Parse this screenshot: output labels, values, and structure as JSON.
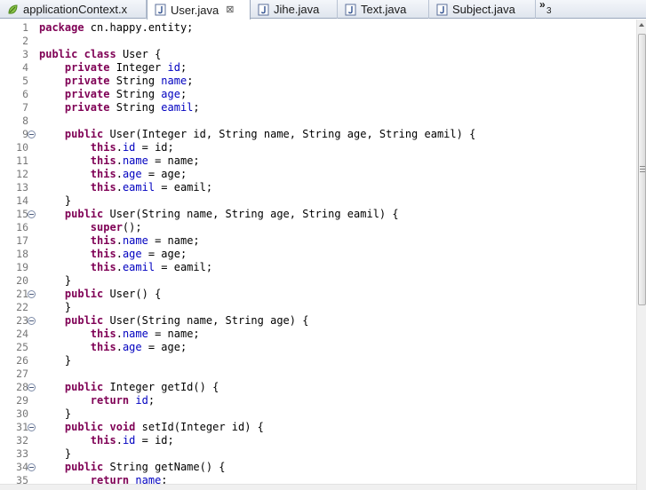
{
  "tabs": [
    {
      "label": "applicationContext.x",
      "icon": "xml-file-icon"
    },
    {
      "label": "User.java",
      "icon": "java-file-icon",
      "active": true,
      "close": "⊠"
    },
    {
      "label": "Jihe.java",
      "icon": "java-file-icon"
    },
    {
      "label": "Text.java",
      "icon": "java-file-icon"
    },
    {
      "label": "Subject.java",
      "icon": "java-file-icon"
    }
  ],
  "overflow": {
    "chevron": "»",
    "count": "3"
  },
  "colors": {
    "keyword": "#7f0055",
    "field": "#0000c0",
    "line_number": "#787878"
  },
  "lines": [
    {
      "n": "1",
      "fold": false,
      "tokens": [
        [
          "kw",
          "package"
        ],
        [
          "pl",
          " cn.happy.entity;"
        ]
      ]
    },
    {
      "n": "2",
      "fold": false,
      "tokens": []
    },
    {
      "n": "3",
      "fold": false,
      "tokens": [
        [
          "kw",
          "public"
        ],
        [
          "pl",
          " "
        ],
        [
          "kw",
          "class"
        ],
        [
          "pl",
          " User {"
        ]
      ]
    },
    {
      "n": "4",
      "fold": false,
      "tokens": [
        [
          "pl",
          "    "
        ],
        [
          "kw",
          "private"
        ],
        [
          "pl",
          " Integer "
        ],
        [
          "fd",
          "id"
        ],
        [
          "pl",
          ";"
        ]
      ]
    },
    {
      "n": "5",
      "fold": false,
      "tokens": [
        [
          "pl",
          "    "
        ],
        [
          "kw",
          "private"
        ],
        [
          "pl",
          " String "
        ],
        [
          "fd",
          "name"
        ],
        [
          "pl",
          ";"
        ]
      ]
    },
    {
      "n": "6",
      "fold": false,
      "tokens": [
        [
          "pl",
          "    "
        ],
        [
          "kw",
          "private"
        ],
        [
          "pl",
          " String "
        ],
        [
          "fd",
          "age"
        ],
        [
          "pl",
          ";"
        ]
      ]
    },
    {
      "n": "7",
      "fold": false,
      "tokens": [
        [
          "pl",
          "    "
        ],
        [
          "kw",
          "private"
        ],
        [
          "pl",
          " String "
        ],
        [
          "fd",
          "eamil"
        ],
        [
          "pl",
          ";"
        ]
      ]
    },
    {
      "n": "8",
      "fold": false,
      "tokens": []
    },
    {
      "n": "9",
      "fold": true,
      "tokens": [
        [
          "pl",
          "    "
        ],
        [
          "kw",
          "public"
        ],
        [
          "pl",
          " User(Integer id, String name, String age, String eamil) {"
        ]
      ]
    },
    {
      "n": "10",
      "fold": false,
      "tokens": [
        [
          "pl",
          "        "
        ],
        [
          "kw",
          "this"
        ],
        [
          "pl",
          "."
        ],
        [
          "fd",
          "id"
        ],
        [
          "pl",
          " = id;"
        ]
      ]
    },
    {
      "n": "11",
      "fold": false,
      "tokens": [
        [
          "pl",
          "        "
        ],
        [
          "kw",
          "this"
        ],
        [
          "pl",
          "."
        ],
        [
          "fd",
          "name"
        ],
        [
          "pl",
          " = name;"
        ]
      ]
    },
    {
      "n": "12",
      "fold": false,
      "tokens": [
        [
          "pl",
          "        "
        ],
        [
          "kw",
          "this"
        ],
        [
          "pl",
          "."
        ],
        [
          "fd",
          "age"
        ],
        [
          "pl",
          " = age;"
        ]
      ]
    },
    {
      "n": "13",
      "fold": false,
      "tokens": [
        [
          "pl",
          "        "
        ],
        [
          "kw",
          "this"
        ],
        [
          "pl",
          "."
        ],
        [
          "fd",
          "eamil"
        ],
        [
          "pl",
          " = eamil;"
        ]
      ]
    },
    {
      "n": "14",
      "fold": false,
      "tokens": [
        [
          "pl",
          "    }"
        ]
      ]
    },
    {
      "n": "15",
      "fold": true,
      "tokens": [
        [
          "pl",
          "    "
        ],
        [
          "kw",
          "public"
        ],
        [
          "pl",
          " User(String name, String age, String eamil) {"
        ]
      ]
    },
    {
      "n": "16",
      "fold": false,
      "tokens": [
        [
          "pl",
          "        "
        ],
        [
          "kw",
          "super"
        ],
        [
          "pl",
          "();"
        ]
      ]
    },
    {
      "n": "17",
      "fold": false,
      "tokens": [
        [
          "pl",
          "        "
        ],
        [
          "kw",
          "this"
        ],
        [
          "pl",
          "."
        ],
        [
          "fd",
          "name"
        ],
        [
          "pl",
          " = name;"
        ]
      ]
    },
    {
      "n": "18",
      "fold": false,
      "tokens": [
        [
          "pl",
          "        "
        ],
        [
          "kw",
          "this"
        ],
        [
          "pl",
          "."
        ],
        [
          "fd",
          "age"
        ],
        [
          "pl",
          " = age;"
        ]
      ]
    },
    {
      "n": "19",
      "fold": false,
      "tokens": [
        [
          "pl",
          "        "
        ],
        [
          "kw",
          "this"
        ],
        [
          "pl",
          "."
        ],
        [
          "fd",
          "eamil"
        ],
        [
          "pl",
          " = eamil;"
        ]
      ]
    },
    {
      "n": "20",
      "fold": false,
      "tokens": [
        [
          "pl",
          "    }"
        ]
      ]
    },
    {
      "n": "21",
      "fold": true,
      "tokens": [
        [
          "pl",
          "    "
        ],
        [
          "kw",
          "public"
        ],
        [
          "pl",
          " User() {"
        ]
      ]
    },
    {
      "n": "22",
      "fold": false,
      "tokens": [
        [
          "pl",
          "    }"
        ]
      ]
    },
    {
      "n": "23",
      "fold": true,
      "tokens": [
        [
          "pl",
          "    "
        ],
        [
          "kw",
          "public"
        ],
        [
          "pl",
          " User(String name, String age) {"
        ]
      ]
    },
    {
      "n": "24",
      "fold": false,
      "tokens": [
        [
          "pl",
          "        "
        ],
        [
          "kw",
          "this"
        ],
        [
          "pl",
          "."
        ],
        [
          "fd",
          "name"
        ],
        [
          "pl",
          " = name;"
        ]
      ]
    },
    {
      "n": "25",
      "fold": false,
      "tokens": [
        [
          "pl",
          "        "
        ],
        [
          "kw",
          "this"
        ],
        [
          "pl",
          "."
        ],
        [
          "fd",
          "age"
        ],
        [
          "pl",
          " = age;"
        ]
      ]
    },
    {
      "n": "26",
      "fold": false,
      "tokens": [
        [
          "pl",
          "    }"
        ]
      ]
    },
    {
      "n": "27",
      "fold": false,
      "tokens": []
    },
    {
      "n": "28",
      "fold": true,
      "tokens": [
        [
          "pl",
          "    "
        ],
        [
          "kw",
          "public"
        ],
        [
          "pl",
          " Integer getId() {"
        ]
      ]
    },
    {
      "n": "29",
      "fold": false,
      "tokens": [
        [
          "pl",
          "        "
        ],
        [
          "kw",
          "return"
        ],
        [
          "pl",
          " "
        ],
        [
          "fd",
          "id"
        ],
        [
          "pl",
          ";"
        ]
      ]
    },
    {
      "n": "30",
      "fold": false,
      "tokens": [
        [
          "pl",
          "    }"
        ]
      ]
    },
    {
      "n": "31",
      "fold": true,
      "tokens": [
        [
          "pl",
          "    "
        ],
        [
          "kw",
          "public"
        ],
        [
          "pl",
          " "
        ],
        [
          "kw",
          "void"
        ],
        [
          "pl",
          " setId(Integer id) {"
        ]
      ]
    },
    {
      "n": "32",
      "fold": false,
      "tokens": [
        [
          "pl",
          "        "
        ],
        [
          "kw",
          "this"
        ],
        [
          "pl",
          "."
        ],
        [
          "fd",
          "id"
        ],
        [
          "pl",
          " = id;"
        ]
      ]
    },
    {
      "n": "33",
      "fold": false,
      "tokens": [
        [
          "pl",
          "    }"
        ]
      ]
    },
    {
      "n": "34",
      "fold": true,
      "tokens": [
        [
          "pl",
          "    "
        ],
        [
          "kw",
          "public"
        ],
        [
          "pl",
          " String getName() {"
        ]
      ]
    },
    {
      "n": "35",
      "fold": false,
      "tokens": [
        [
          "pl",
          "        "
        ],
        [
          "kw",
          "return"
        ],
        [
          "pl",
          " "
        ],
        [
          "fd",
          "name"
        ],
        [
          "pl",
          ";"
        ]
      ]
    }
  ]
}
